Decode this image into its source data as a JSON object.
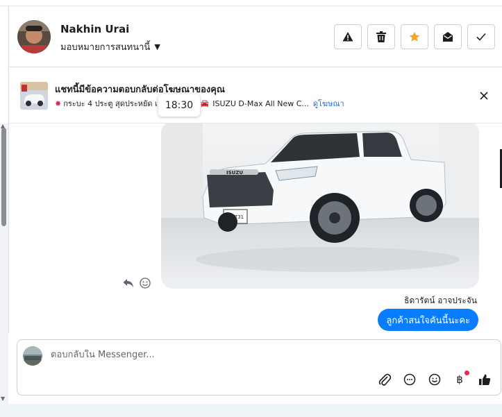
{
  "header": {
    "user_name": "Nakhin Urai",
    "assign_label": "มอบหมายการสนทนานี้",
    "actions": [
      {
        "name": "report-button",
        "icon": "warning-icon"
      },
      {
        "name": "delete-button",
        "icon": "trash-icon"
      },
      {
        "name": "star-button",
        "icon": "star-icon",
        "color": "#f5a623"
      },
      {
        "name": "mark-unread-button",
        "icon": "envelope-open-icon"
      },
      {
        "name": "mark-done-button",
        "icon": "check-icon"
      }
    ]
  },
  "banner": {
    "title": "แชทนี้มีข้อความตอบกลับต่อโฆษณาของคุณ",
    "subtitle_left": "กระบะ 4 ประตู สุดประหยัด เ",
    "subtitle_right": "ISUZU D-Max All New C...",
    "see_ad": "ดูโฆษณา"
  },
  "tooltip": {
    "time": "18:30"
  },
  "chat": {
    "plate_text": "กล 731",
    "brand_text": "ISUZU",
    "sender_name": "ธิดารัตน์ อาจประจัน",
    "message": "ลูกค้าสนใจคันนี้นะคะ"
  },
  "composer": {
    "placeholder": "ตอบกลับใน Messenger..."
  },
  "colors": {
    "accent": "#0a7cff",
    "link": "#216fdb",
    "star": "#f5a623",
    "notify_dot": "#f02849"
  }
}
